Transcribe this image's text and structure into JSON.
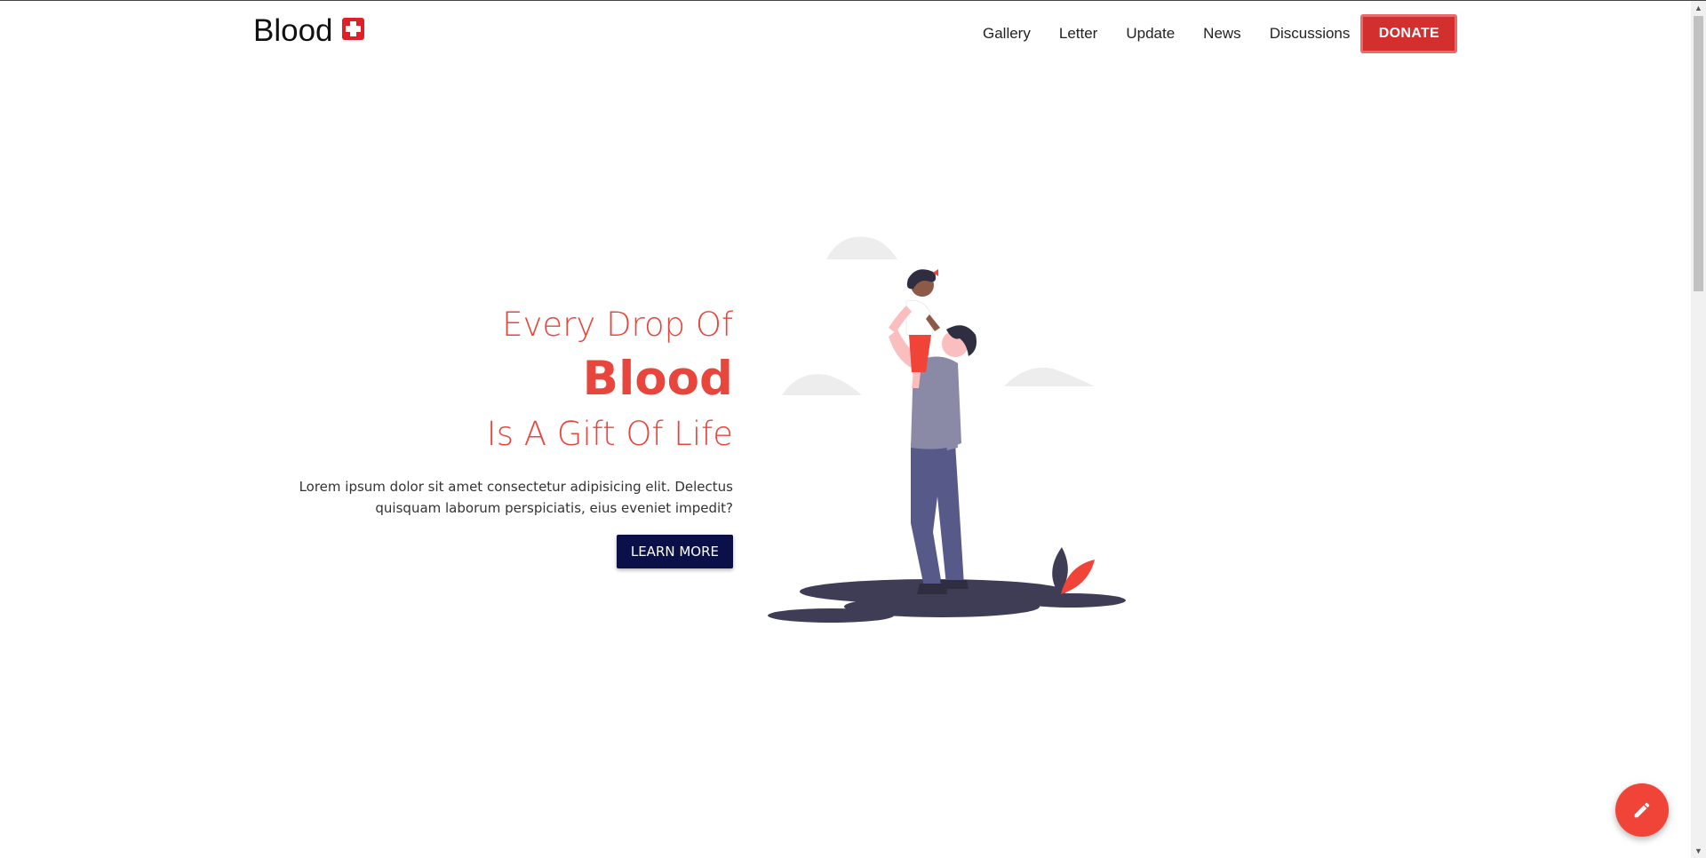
{
  "brand": {
    "name": "Blood",
    "icon": "medical-cross-icon"
  },
  "nav": {
    "items": [
      {
        "label": "Gallery"
      },
      {
        "label": "Letter"
      },
      {
        "label": "Update"
      },
      {
        "label": "News"
      },
      {
        "label": "Discussions"
      }
    ],
    "donate_label": "DONATE"
  },
  "hero": {
    "line1": "Every Drop Of",
    "line2": "Blood",
    "line3": "Is A Gift Of Life",
    "description_line1": "Lorem ipsum dolor sit amet consectetur adipisicing elit. Delectus",
    "description_line2": "quisquam laborum perspiciatis, eius eveniet impedit?",
    "cta_label": "LEARN MORE"
  },
  "fab": {
    "icon": "pencil-icon"
  },
  "colors": {
    "accent": "#e8453c",
    "donate": "#d32f2f",
    "cta": "#0b1048",
    "fab": "#f04438"
  }
}
